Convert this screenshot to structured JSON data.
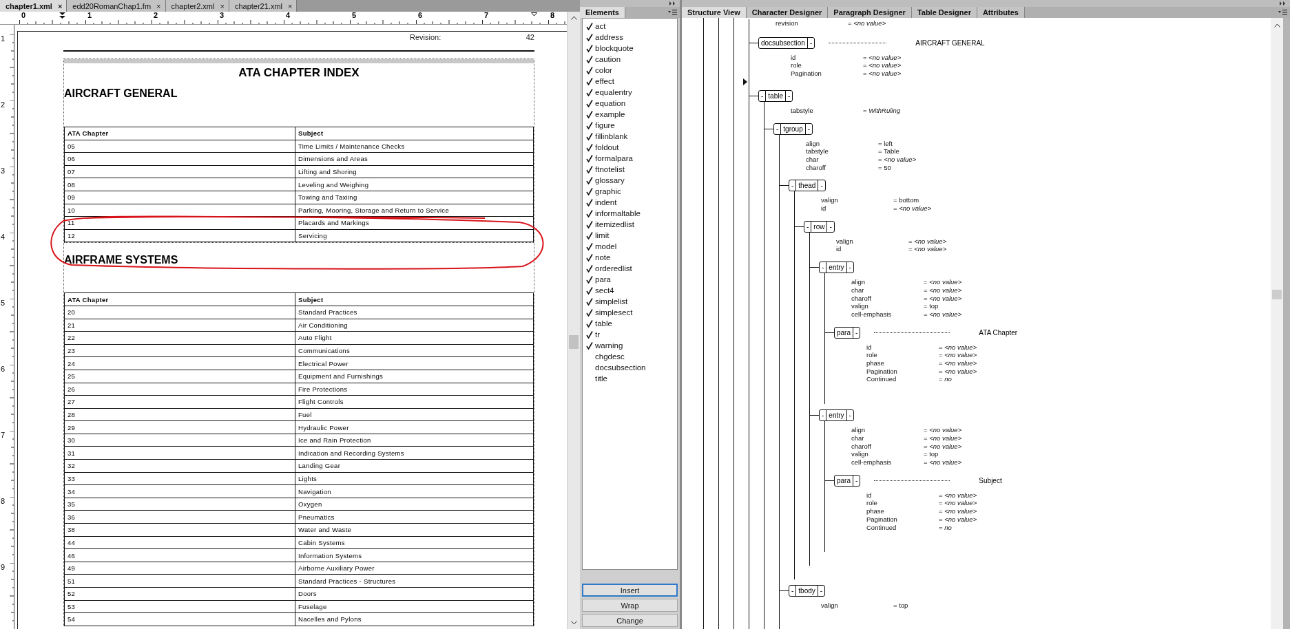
{
  "document_tabs": [
    {
      "label": "chapter1.xml",
      "close": "×",
      "selected": true
    },
    {
      "label": "edd20RomanChap1.fm",
      "close": "×",
      "selected": false
    },
    {
      "label": "chapter2.xml",
      "close": "×",
      "selected": false
    },
    {
      "label": "chapter21.xml",
      "close": "×",
      "selected": false
    }
  ],
  "ruler": {
    "marks": [
      "0",
      "1",
      "2",
      "3",
      "4",
      "5",
      "6",
      "7",
      "8"
    ]
  },
  "vertical_ruler": {
    "marks": [
      "1",
      "2",
      "3",
      "4",
      "5",
      "6",
      "7",
      "8",
      "9"
    ]
  },
  "page": {
    "revision_label": "Revision:",
    "revision_value": "42",
    "title": "ATA CHAPTER INDEX",
    "annotation": {
      "kind": "freehand-ellipse"
    },
    "sections": [
      {
        "heading": "AIRCRAFT GENERAL",
        "columns": [
          "ATA Chapter",
          "Subject"
        ],
        "rows": [
          [
            "05",
            "Time Limits / Maintenance Checks"
          ],
          [
            "06",
            "Dimensions and Areas"
          ],
          [
            "07",
            "Lifting and Shoring"
          ],
          [
            "08",
            "Leveling and Weighing"
          ],
          [
            "09",
            "Towing and Taxiing"
          ],
          [
            "10",
            "Parking, Mooring, Storage and Return to Service"
          ],
          [
            "11",
            "Placards and Markings"
          ],
          [
            "12",
            "Servicing"
          ]
        ]
      },
      {
        "heading": "AIRFRAME SYSTEMS",
        "columns": [
          "ATA Chapter",
          "Subject"
        ],
        "rows": [
          [
            "20",
            "Standard Practices"
          ],
          [
            "21",
            "Air Conditioning"
          ],
          [
            "22",
            "Auto Flight"
          ],
          [
            "23",
            "Communications"
          ],
          [
            "24",
            "Electrical Power"
          ],
          [
            "25",
            "Equipment and Furnishings"
          ],
          [
            "26",
            "Fire Protections"
          ],
          [
            "27",
            "Flight Controls"
          ],
          [
            "28",
            "Fuel"
          ],
          [
            "29",
            "Hydraulic Power"
          ],
          [
            "30",
            "Ice and Rain Protection"
          ],
          [
            "31",
            "Indication and Recording Systems"
          ],
          [
            "32",
            "Landing Gear"
          ],
          [
            "33",
            "Lights"
          ],
          [
            "34",
            "Navigation"
          ],
          [
            "35",
            "Oxygen"
          ],
          [
            "36",
            "Pneumatics"
          ],
          [
            "38",
            "Water and Waste"
          ],
          [
            "44",
            "Cabin Systems"
          ],
          [
            "46",
            "Information Systems"
          ],
          [
            "49",
            "Airborne Auxiliary Power"
          ],
          [
            "51",
            "Standard Practices - Structures"
          ],
          [
            "52",
            "Doors"
          ],
          [
            "53",
            "Fuselage"
          ],
          [
            "54",
            "Nacelles and Pylons"
          ]
        ]
      }
    ]
  },
  "elements_panel": {
    "title": "Elements",
    "items": [
      {
        "label": "act",
        "checked": true
      },
      {
        "label": "address",
        "checked": true
      },
      {
        "label": "blockquote",
        "checked": true
      },
      {
        "label": "caution",
        "checked": true
      },
      {
        "label": "color",
        "checked": true
      },
      {
        "label": "effect",
        "checked": true
      },
      {
        "label": "equalentry",
        "checked": true
      },
      {
        "label": "equation",
        "checked": true
      },
      {
        "label": "example",
        "checked": true
      },
      {
        "label": "figure",
        "checked": true
      },
      {
        "label": "fillinblank",
        "checked": true
      },
      {
        "label": "foldout",
        "checked": true
      },
      {
        "label": "formalpara",
        "checked": true
      },
      {
        "label": "ftnotelist",
        "checked": true
      },
      {
        "label": "glossary",
        "checked": true
      },
      {
        "label": "graphic",
        "checked": true
      },
      {
        "label": "indent",
        "checked": true
      },
      {
        "label": "informaltable",
        "checked": true
      },
      {
        "label": "itemizedlist",
        "checked": true
      },
      {
        "label": "limit",
        "checked": true
      },
      {
        "label": "model",
        "checked": true
      },
      {
        "label": "note",
        "checked": true
      },
      {
        "label": "orderedlist",
        "checked": true
      },
      {
        "label": "para",
        "checked": true
      },
      {
        "label": "sect4",
        "checked": true
      },
      {
        "label": "simplelist",
        "checked": true
      },
      {
        "label": "simplesect",
        "checked": true
      },
      {
        "label": "table",
        "checked": true
      },
      {
        "label": "tr",
        "checked": true
      },
      {
        "label": "warning",
        "checked": true
      },
      {
        "label": "chgdesc",
        "checked": false
      },
      {
        "label": "docsubsection",
        "checked": false
      },
      {
        "label": "title",
        "checked": false
      }
    ],
    "buttons": [
      {
        "label": "Insert",
        "focused": true
      },
      {
        "label": "Wrap",
        "focused": false
      },
      {
        "label": "Change",
        "focused": false
      }
    ]
  },
  "designer_tabs": [
    {
      "label": "Structure View",
      "selected": true
    },
    {
      "label": "Character Designer",
      "selected": false
    },
    {
      "label": "Paragraph Designer",
      "selected": false
    },
    {
      "label": "Table Designer",
      "selected": false
    },
    {
      "label": "Attributes",
      "selected": false
    }
  ],
  "structure_tree": {
    "attributes": [
      {
        "name": "revision",
        "value": "= *<no value>*"
      }
    ],
    "children": [
      {
        "element": "docsubsection",
        "post": "-",
        "content": "AIRCRAFT GENERAL",
        "attributes": [
          {
            "name": "id",
            "value": "= *<no value>*"
          },
          {
            "name": "role",
            "value": "= *<no value>*"
          },
          {
            "name": "Pagination",
            "value": "= *<no value>*"
          }
        ]
      },
      {
        "element": "table",
        "pre": "-",
        "post": "-",
        "insertion_point": true,
        "attributes": [
          {
            "name": "tabstyle",
            "value": "= *WithRuling*"
          }
        ],
        "children": [
          {
            "element": "tgroup",
            "pre": "-",
            "post": "-",
            "attributes": [
              {
                "name": "align",
                "value": "= left"
              },
              {
                "name": "tabstyle",
                "value": "= Table"
              },
              {
                "name": "char",
                "value": "= *<no value>*"
              },
              {
                "name": "charoff",
                "value": "= 50"
              }
            ],
            "children": [
              {
                "element": "thead",
                "pre": "-",
                "post": "-",
                "attributes": [
                  {
                    "name": "valign",
                    "value": "= bottom"
                  },
                  {
                    "name": "id",
                    "value": "= *<no value>*"
                  }
                ],
                "children": [
                  {
                    "element": "row",
                    "pre": "-",
                    "post": "-",
                    "attributes": [
                      {
                        "name": "valign",
                        "value": "= *<no value>*"
                      },
                      {
                        "name": "id",
                        "value": "= *<no value>*"
                      }
                    ],
                    "children": [
                      {
                        "element": "entry",
                        "pre": "-",
                        "post": "-",
                        "attributes": [
                          {
                            "name": "align",
                            "value": "= *<no value>*"
                          },
                          {
                            "name": "char",
                            "value": "= *<no value>*"
                          },
                          {
                            "name": "charoff",
                            "value": "= *<no value>*"
                          },
                          {
                            "name": "valign",
                            "value": "= top"
                          },
                          {
                            "name": "cell-emphasis",
                            "value": "= *<no value>*"
                          }
                        ],
                        "children": [
                          {
                            "element": "para",
                            "post": "-",
                            "content": "ATA Chapter",
                            "attributes": [
                              {
                                "name": "id",
                                "value": "= *<no value>*"
                              },
                              {
                                "name": "role",
                                "value": "= *<no value>*"
                              },
                              {
                                "name": "phase",
                                "value": "= *<no value>*"
                              },
                              {
                                "name": "Pagination",
                                "value": "= *<no value>*"
                              },
                              {
                                "name": "Continued",
                                "value": "= *no*"
                              }
                            ]
                          }
                        ]
                      },
                      {
                        "element": "entry",
                        "pre": "-",
                        "post": "-",
                        "attributes": [
                          {
                            "name": "align",
                            "value": "= *<no value>*"
                          },
                          {
                            "name": "char",
                            "value": "= *<no value>*"
                          },
                          {
                            "name": "charoff",
                            "value": "= *<no value>*"
                          },
                          {
                            "name": "valign",
                            "value": "= top"
                          },
                          {
                            "name": "cell-emphasis",
                            "value": "= *<no value>*"
                          }
                        ],
                        "children": [
                          {
                            "element": "para",
                            "post": "-",
                            "content": "Subject",
                            "attributes": [
                              {
                                "name": "id",
                                "value": "= *<no value>*"
                              },
                              {
                                "name": "role",
                                "value": "= *<no value>*"
                              },
                              {
                                "name": "phase",
                                "value": "= *<no value>*"
                              },
                              {
                                "name": "Pagination",
                                "value": "= *<no value>*"
                              },
                              {
                                "name": "Continued",
                                "value": "= *no*"
                              }
                            ]
                          }
                        ]
                      }
                    ]
                  }
                ]
              },
              {
                "element": "tbody",
                "pre": "-",
                "post": "-",
                "attributes": [
                  {
                    "name": "valign",
                    "value": "= top"
                  }
                ]
              }
            ]
          }
        ]
      }
    ]
  }
}
